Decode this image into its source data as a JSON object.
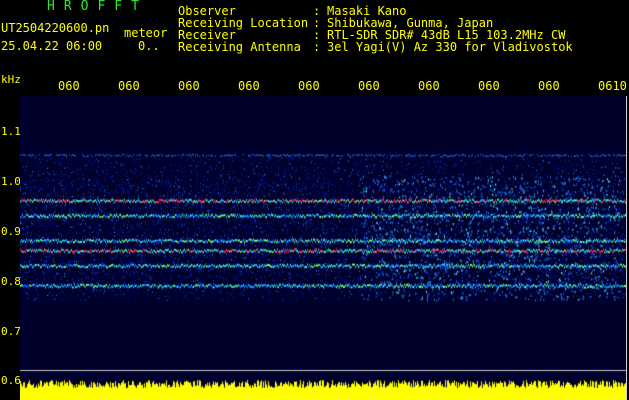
{
  "header": {
    "brand": "HROFFT",
    "file_name": "UT2504220600.pn",
    "meteor_label": "meteor",
    "date_time": "25.04.22 06:00",
    "count": "0.."
  },
  "info": [
    {
      "label": "Observer",
      "value": "Masaki Kano"
    },
    {
      "label": "Receiving Location",
      "value": "Shibukawa, Gunma, Japan"
    },
    {
      "label": "Receiver",
      "value": "RTL-SDR SDR# 43dB L15 103.2MHz CW"
    },
    {
      "label": "Receiving Antenna",
      "value": "3el Yagi(V) Az 330 for Vladivostok"
    }
  ],
  "spectrogram": {
    "frequency_unit": "kHz",
    "time_labels": [
      "060",
      "060",
      "060",
      "060",
      "060",
      "060",
      "060",
      "060",
      "060",
      "0610"
    ],
    "frequency_labels": [
      "1.1",
      "1.0",
      "0.9",
      "0.8",
      "0.7",
      "0.6"
    ],
    "frequency_range_khz": [
      0.6,
      1.1
    ],
    "signal_band_khz": [
      0.76,
      1.05
    ],
    "strong_lines_khz": [
      0.96,
      0.93,
      0.88,
      0.86,
      0.83,
      0.79
    ],
    "colors": {
      "background": "#000000",
      "plot_background": "#00002c",
      "noise_floor_bar": "#ffff00",
      "text": "#ffff00",
      "brand": "#2ee82e"
    }
  }
}
